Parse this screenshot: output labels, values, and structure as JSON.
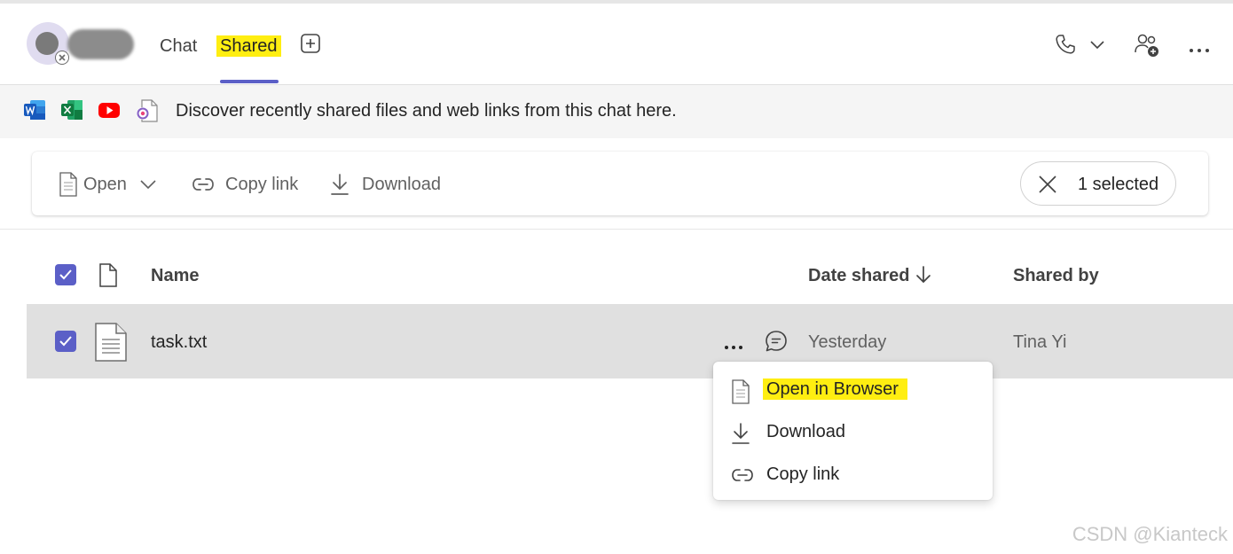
{
  "header": {
    "tabs": [
      {
        "label": "Chat",
        "active": false
      },
      {
        "label": "Shared",
        "active": true
      }
    ],
    "accent_color": "#5b5fc7",
    "highlight_color": "#ffee11"
  },
  "banner": {
    "icons": [
      "word-icon",
      "excel-icon",
      "youtube-icon",
      "loop-file-icon"
    ],
    "text": "Discover recently shared files and web links from this chat here."
  },
  "toolbar": {
    "open_label": "Open",
    "copy_link_label": "Copy link",
    "download_label": "Download",
    "selected_label": "1 selected"
  },
  "table": {
    "columns": {
      "name": "Name",
      "date_shared": "Date shared",
      "shared_by": "Shared by"
    },
    "sort": {
      "column": "date_shared",
      "direction": "descending"
    },
    "rows": [
      {
        "name": "task.txt",
        "date_shared": "Yesterday",
        "shared_by": "Tina Yi",
        "selected": true
      }
    ]
  },
  "context_menu": {
    "items": [
      {
        "label": "Open in Browser",
        "icon": "document-icon",
        "highlighted": true
      },
      {
        "label": "Download",
        "icon": "download-icon"
      },
      {
        "label": "Copy link",
        "icon": "link-icon"
      }
    ]
  },
  "watermark": "CSDN @Kianteck"
}
